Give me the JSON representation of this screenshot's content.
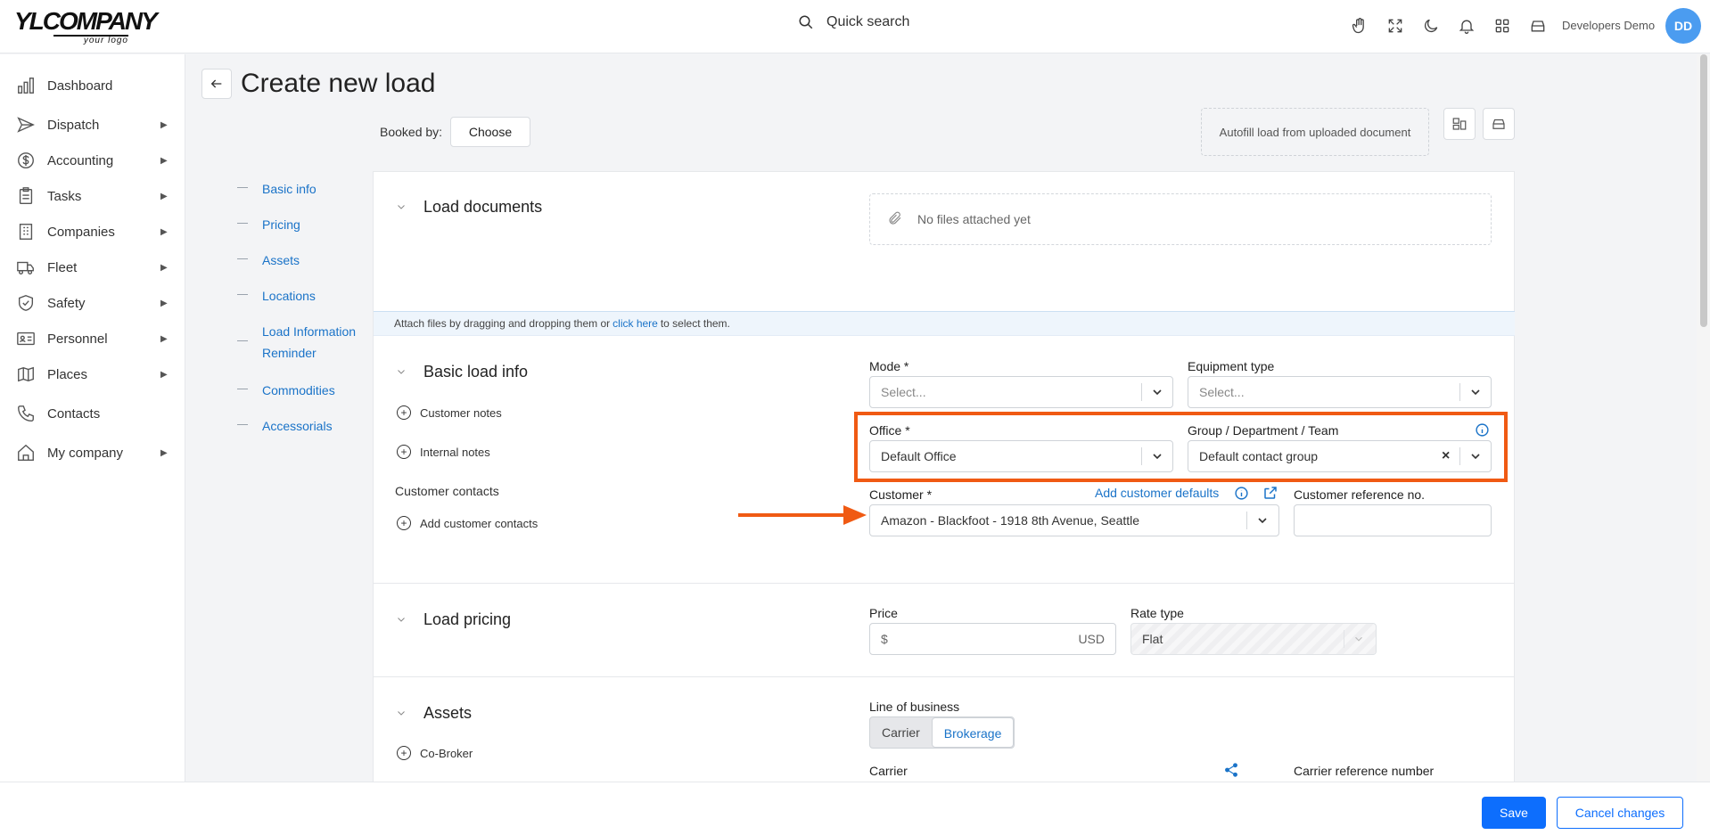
{
  "header": {
    "logo_main": "YLCOMPANY",
    "logo_sub": "your logo",
    "search_label": "Quick search",
    "user_name": "Developers Demo",
    "avatar_initials": "DD",
    "icons": [
      "hand-icon",
      "fullscreen-icon",
      "moon-icon",
      "bell-icon",
      "apps-grid-icon",
      "archive-icon"
    ]
  },
  "sidebar": {
    "items": [
      {
        "label": "Dashboard",
        "icon": "chart-bars-icon",
        "expandable": false
      },
      {
        "label": "Dispatch",
        "icon": "send-icon",
        "expandable": true
      },
      {
        "label": "Accounting",
        "icon": "dollar-circle-icon",
        "expandable": true
      },
      {
        "label": "Tasks",
        "icon": "clipboard-icon",
        "expandable": true
      },
      {
        "label": "Companies",
        "icon": "building-icon",
        "expandable": true
      },
      {
        "label": "Fleet",
        "icon": "truck-icon",
        "expandable": true
      },
      {
        "label": "Safety",
        "icon": "shield-icon",
        "expandable": true
      },
      {
        "label": "Personnel",
        "icon": "id-card-icon",
        "expandable": true
      },
      {
        "label": "Places",
        "icon": "map-icon",
        "expandable": true
      },
      {
        "label": "Contacts",
        "icon": "phone-icon",
        "expandable": false
      },
      {
        "label": "My company",
        "icon": "home-icon",
        "expandable": true
      }
    ]
  },
  "page": {
    "title": "Create new load",
    "booked_by_label": "Booked by:",
    "choose_label": "Choose",
    "autofill_label": "Autofill load from uploaded document"
  },
  "toc": [
    "Basic info",
    "Pricing",
    "Assets",
    "Locations",
    "Load Information Reminder",
    "Commodities",
    "Accessorials"
  ],
  "documents": {
    "title": "Load documents",
    "empty_text": "No files attached yet",
    "attach_prefix": "Attach files by dragging and dropping them or",
    "attach_link": "click here",
    "attach_suffix": "to select them."
  },
  "basic": {
    "title": "Basic load info",
    "customer_notes": "Customer notes",
    "internal_notes": "Internal notes",
    "customer_contacts_label": "Customer contacts",
    "add_customer_contacts": "Add customer contacts",
    "mode_label": "Mode *",
    "mode_placeholder": "Select...",
    "equipment_label": "Equipment type",
    "equipment_placeholder": "Select...",
    "office_label": "Office *",
    "office_value": "Default Office",
    "group_label": "Group / Department / Team",
    "group_value": "Default contact group",
    "customer_label": "Customer *",
    "add_customer_defaults": "Add customer defaults",
    "customer_value": "Amazon - Blackfoot - 1918 8th Avenue, Seattle",
    "customer_ref_label": "Customer reference no."
  },
  "pricing": {
    "title": "Load pricing",
    "price_label": "Price",
    "currency_symbol": "$",
    "currency_code": "USD",
    "rate_type_label": "Rate type",
    "rate_type_value": "Flat"
  },
  "assets": {
    "title": "Assets",
    "co_broker": "Co-Broker",
    "line_of_business_label": "Line of business",
    "lob_options": [
      "Carrier",
      "Brokerage"
    ],
    "lob_selected": "Brokerage",
    "carrier_label": "Carrier",
    "carrier_ref_label": "Carrier reference number"
  },
  "footer": {
    "save_label": "Save",
    "cancel_label": "Cancel changes"
  },
  "colors": {
    "accent": "#1a73c8",
    "primary_button": "#0d6efd",
    "annotation": "#f05a13",
    "avatar": "#4b9cf0"
  }
}
